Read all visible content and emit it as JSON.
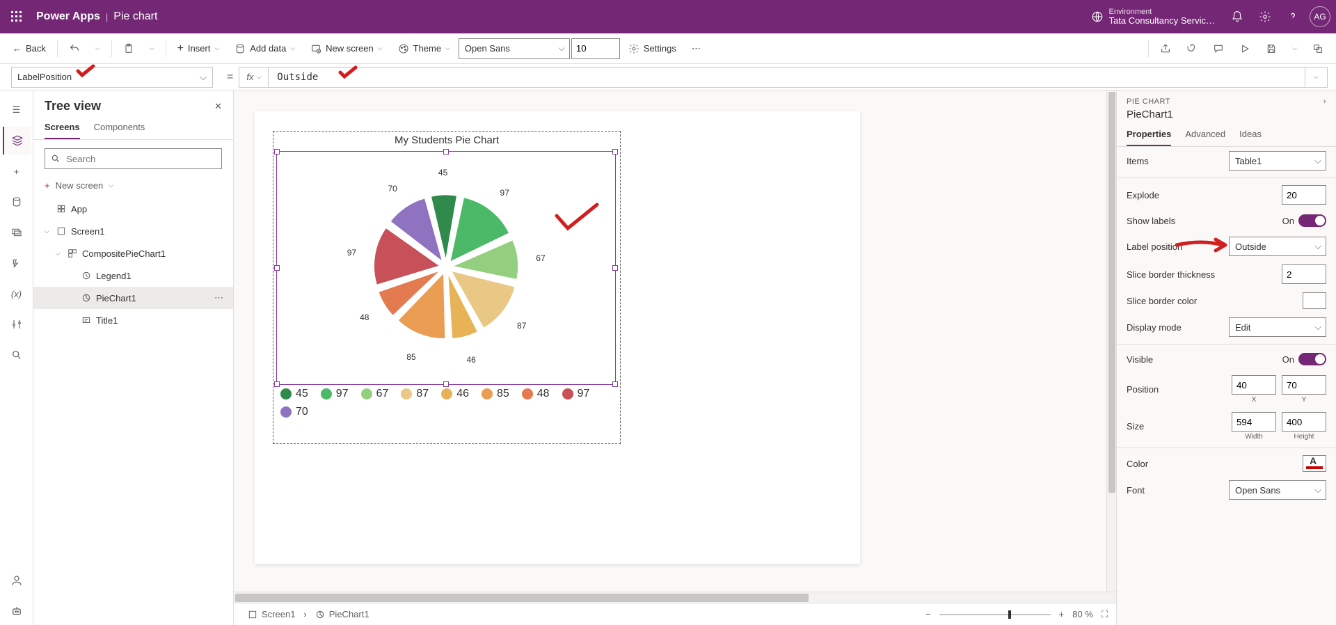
{
  "header": {
    "brand": "Power Apps",
    "page": "Pie chart",
    "env_label": "Environment",
    "env_name": "Tata Consultancy Servic…",
    "avatar": "AG"
  },
  "cmdbar": {
    "back": "Back",
    "insert": "Insert",
    "add_data": "Add data",
    "new_screen": "New screen",
    "theme": "Theme",
    "font": "Open Sans",
    "font_size": "10",
    "settings": "Settings"
  },
  "formula": {
    "property": "LabelPosition",
    "value": "Outside"
  },
  "tree": {
    "title": "Tree view",
    "tab_screens": "Screens",
    "tab_components": "Components",
    "search_ph": "Search",
    "new_screen": "New screen",
    "app": "App",
    "screen1": "Screen1",
    "composite": "CompositePieChart1",
    "legend": "Legend1",
    "piechart": "PieChart1",
    "title_ctrl": "Title1"
  },
  "canvas": {
    "chart_title": "My Students Pie Chart"
  },
  "chart_data": {
    "type": "pie",
    "title": "My Students Pie Chart",
    "categories": [
      "45",
      "97",
      "67",
      "87",
      "46",
      "85",
      "48",
      "97",
      "70"
    ],
    "values": [
      45,
      97,
      67,
      87,
      46,
      85,
      48,
      97,
      70
    ],
    "colors": [
      "#2f8a4b",
      "#4cb968",
      "#94cf7f",
      "#e8c884",
      "#e8b257",
      "#eb9c53",
      "#e47a4f",
      "#c85058",
      "#8f72c0"
    ],
    "data_labels": [
      "45",
      "97",
      "67",
      "87",
      "46",
      "85",
      "48",
      "97",
      "70"
    ],
    "legend_position": "bottom"
  },
  "footer": {
    "screen": "Screen1",
    "control": "PieChart1",
    "zoom": "80 %"
  },
  "props": {
    "type": "PIE CHART",
    "name": "PieChart1",
    "tab_props": "Properties",
    "tab_adv": "Advanced",
    "tab_ideas": "Ideas",
    "items_lbl": "Items",
    "items_val": "Table1",
    "explode_lbl": "Explode",
    "explode_val": "20",
    "showlabels_lbl": "Show labels",
    "on": "On",
    "labelpos_lbl": "Label position",
    "labelpos_val": "Outside",
    "border_lbl": "Slice border thickness",
    "border_val": "2",
    "bordercolor_lbl": "Slice border color",
    "display_lbl": "Display mode",
    "display_val": "Edit",
    "visible_lbl": "Visible",
    "position_lbl": "Position",
    "pos_x": "40",
    "pos_y": "70",
    "x": "X",
    "y": "Y",
    "size_lbl": "Size",
    "width": "594",
    "height": "400",
    "width_lbl": "Width",
    "height_lbl": "Height",
    "color_lbl": "Color",
    "font_lbl": "Font",
    "font_val": "Open Sans"
  }
}
